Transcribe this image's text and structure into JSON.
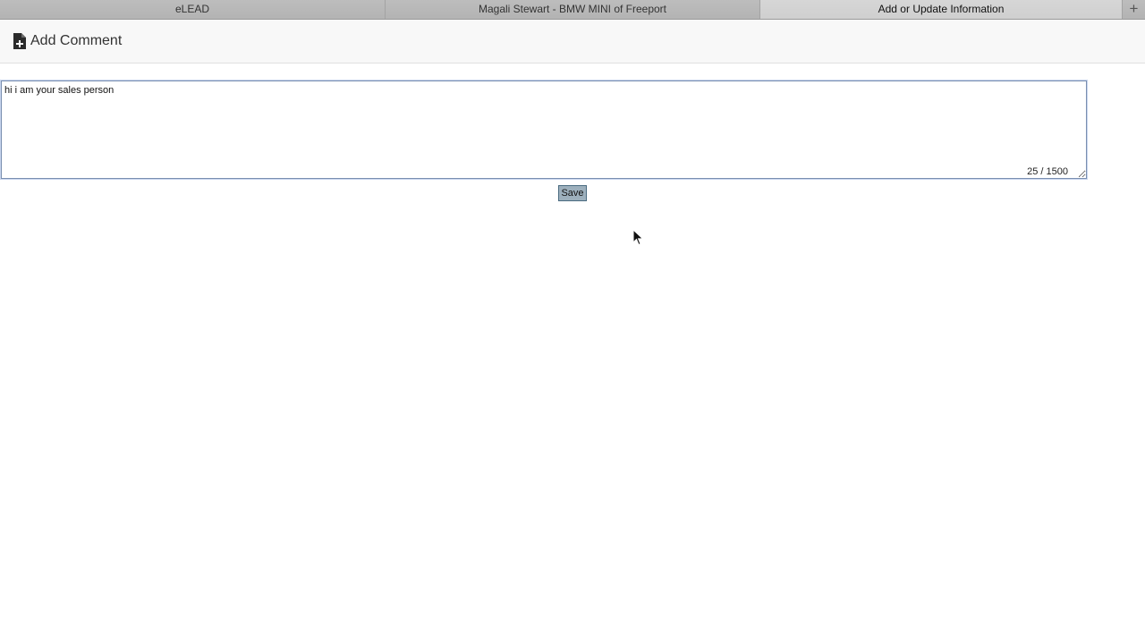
{
  "tabs": [
    {
      "label": "eLEAD",
      "active": false
    },
    {
      "label": "Magali Stewart - BMW MINI of Freeport",
      "active": false
    },
    {
      "label": "Add or Update Information",
      "active": true
    }
  ],
  "tab_add_icon": "plus-icon",
  "header": {
    "icon": "file-plus-icon",
    "title": "Add Comment"
  },
  "comment": {
    "value": "hi i am your sales person",
    "char_count": "25 / 1500"
  },
  "actions": {
    "save_label": "Save"
  }
}
